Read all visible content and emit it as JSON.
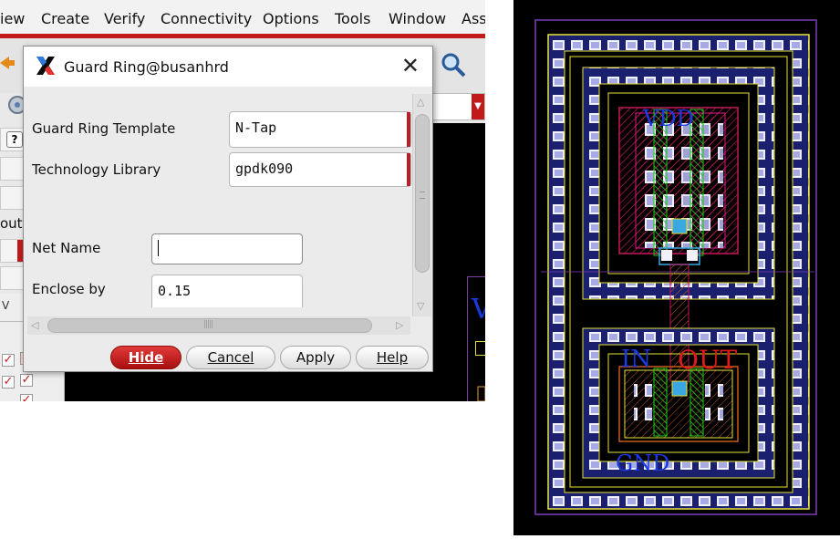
{
  "menubar": {
    "items": [
      "iew",
      "Create",
      "Verify",
      "Connectivity",
      "Options",
      "Tools",
      "Window",
      "Ass"
    ]
  },
  "left_panel": {
    "fragment_label": "outi"
  },
  "dialog": {
    "title": "Guard Ring@busanhrd",
    "fields": {
      "guard_ring_template": {
        "label": "Guard Ring Template",
        "value": "N-Tap"
      },
      "technology_library": {
        "label": "Technology Library",
        "value": "gpdk090"
      },
      "net_name": {
        "label": "Net Name",
        "value": ""
      },
      "enclose_by": {
        "label": "Enclose by",
        "value": "0.15"
      }
    },
    "buttons": {
      "hide": "Hide",
      "cancel": "Cancel",
      "apply": "Apply",
      "help": "Help"
    }
  },
  "layout": {
    "labels": {
      "vdd": "VDD",
      "in": "IN",
      "out": "OUT",
      "gnd": "GND"
    },
    "colors": {
      "background": "#000000",
      "boundary": "#7b3fb5",
      "metal": "#e8e23c",
      "poly": "#23c81e",
      "pwell": "#c2185b",
      "contact": "#3ba7e0",
      "label_blue": "#1a3be0",
      "label_red": "#e01a1a"
    }
  }
}
